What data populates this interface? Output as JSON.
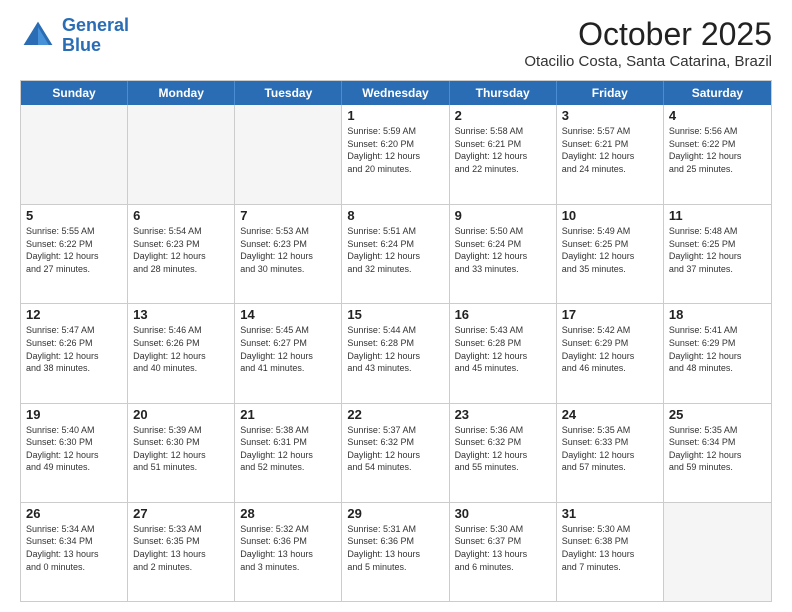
{
  "header": {
    "logo_line1": "General",
    "logo_line2": "Blue",
    "month": "October 2025",
    "location": "Otacilio Costa, Santa Catarina, Brazil"
  },
  "weekdays": [
    "Sunday",
    "Monday",
    "Tuesday",
    "Wednesday",
    "Thursday",
    "Friday",
    "Saturday"
  ],
  "rows": [
    [
      {
        "day": "",
        "info": ""
      },
      {
        "day": "",
        "info": ""
      },
      {
        "day": "",
        "info": ""
      },
      {
        "day": "1",
        "info": "Sunrise: 5:59 AM\nSunset: 6:20 PM\nDaylight: 12 hours\nand 20 minutes."
      },
      {
        "day": "2",
        "info": "Sunrise: 5:58 AM\nSunset: 6:21 PM\nDaylight: 12 hours\nand 22 minutes."
      },
      {
        "day": "3",
        "info": "Sunrise: 5:57 AM\nSunset: 6:21 PM\nDaylight: 12 hours\nand 24 minutes."
      },
      {
        "day": "4",
        "info": "Sunrise: 5:56 AM\nSunset: 6:22 PM\nDaylight: 12 hours\nand 25 minutes."
      }
    ],
    [
      {
        "day": "5",
        "info": "Sunrise: 5:55 AM\nSunset: 6:22 PM\nDaylight: 12 hours\nand 27 minutes."
      },
      {
        "day": "6",
        "info": "Sunrise: 5:54 AM\nSunset: 6:23 PM\nDaylight: 12 hours\nand 28 minutes."
      },
      {
        "day": "7",
        "info": "Sunrise: 5:53 AM\nSunset: 6:23 PM\nDaylight: 12 hours\nand 30 minutes."
      },
      {
        "day": "8",
        "info": "Sunrise: 5:51 AM\nSunset: 6:24 PM\nDaylight: 12 hours\nand 32 minutes."
      },
      {
        "day": "9",
        "info": "Sunrise: 5:50 AM\nSunset: 6:24 PM\nDaylight: 12 hours\nand 33 minutes."
      },
      {
        "day": "10",
        "info": "Sunrise: 5:49 AM\nSunset: 6:25 PM\nDaylight: 12 hours\nand 35 minutes."
      },
      {
        "day": "11",
        "info": "Sunrise: 5:48 AM\nSunset: 6:25 PM\nDaylight: 12 hours\nand 37 minutes."
      }
    ],
    [
      {
        "day": "12",
        "info": "Sunrise: 5:47 AM\nSunset: 6:26 PM\nDaylight: 12 hours\nand 38 minutes."
      },
      {
        "day": "13",
        "info": "Sunrise: 5:46 AM\nSunset: 6:26 PM\nDaylight: 12 hours\nand 40 minutes."
      },
      {
        "day": "14",
        "info": "Sunrise: 5:45 AM\nSunset: 6:27 PM\nDaylight: 12 hours\nand 41 minutes."
      },
      {
        "day": "15",
        "info": "Sunrise: 5:44 AM\nSunset: 6:28 PM\nDaylight: 12 hours\nand 43 minutes."
      },
      {
        "day": "16",
        "info": "Sunrise: 5:43 AM\nSunset: 6:28 PM\nDaylight: 12 hours\nand 45 minutes."
      },
      {
        "day": "17",
        "info": "Sunrise: 5:42 AM\nSunset: 6:29 PM\nDaylight: 12 hours\nand 46 minutes."
      },
      {
        "day": "18",
        "info": "Sunrise: 5:41 AM\nSunset: 6:29 PM\nDaylight: 12 hours\nand 48 minutes."
      }
    ],
    [
      {
        "day": "19",
        "info": "Sunrise: 5:40 AM\nSunset: 6:30 PM\nDaylight: 12 hours\nand 49 minutes."
      },
      {
        "day": "20",
        "info": "Sunrise: 5:39 AM\nSunset: 6:30 PM\nDaylight: 12 hours\nand 51 minutes."
      },
      {
        "day": "21",
        "info": "Sunrise: 5:38 AM\nSunset: 6:31 PM\nDaylight: 12 hours\nand 52 minutes."
      },
      {
        "day": "22",
        "info": "Sunrise: 5:37 AM\nSunset: 6:32 PM\nDaylight: 12 hours\nand 54 minutes."
      },
      {
        "day": "23",
        "info": "Sunrise: 5:36 AM\nSunset: 6:32 PM\nDaylight: 12 hours\nand 55 minutes."
      },
      {
        "day": "24",
        "info": "Sunrise: 5:35 AM\nSunset: 6:33 PM\nDaylight: 12 hours\nand 57 minutes."
      },
      {
        "day": "25",
        "info": "Sunrise: 5:35 AM\nSunset: 6:34 PM\nDaylight: 12 hours\nand 59 minutes."
      }
    ],
    [
      {
        "day": "26",
        "info": "Sunrise: 5:34 AM\nSunset: 6:34 PM\nDaylight: 13 hours\nand 0 minutes."
      },
      {
        "day": "27",
        "info": "Sunrise: 5:33 AM\nSunset: 6:35 PM\nDaylight: 13 hours\nand 2 minutes."
      },
      {
        "day": "28",
        "info": "Sunrise: 5:32 AM\nSunset: 6:36 PM\nDaylight: 13 hours\nand 3 minutes."
      },
      {
        "day": "29",
        "info": "Sunrise: 5:31 AM\nSunset: 6:36 PM\nDaylight: 13 hours\nand 5 minutes."
      },
      {
        "day": "30",
        "info": "Sunrise: 5:30 AM\nSunset: 6:37 PM\nDaylight: 13 hours\nand 6 minutes."
      },
      {
        "day": "31",
        "info": "Sunrise: 5:30 AM\nSunset: 6:38 PM\nDaylight: 13 hours\nand 7 minutes."
      },
      {
        "day": "",
        "info": ""
      }
    ]
  ]
}
